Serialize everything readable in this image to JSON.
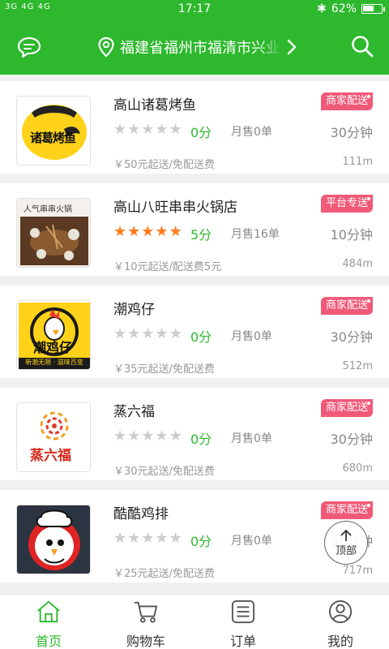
{
  "status": {
    "time": "17:17",
    "network": "3G 4G 4G",
    "battery": "62%",
    "battery_level": 0.62
  },
  "header": {
    "location": "福建省福州市福清市兴业"
  },
  "restaurants": [
    {
      "name": "高山诸葛烤鱼",
      "badge": "商家配送",
      "rating": 0,
      "score": "0分",
      "sales": "月售0单",
      "time": "30分钟",
      "fee": "￥50元起送/免配送费",
      "distance": "111m",
      "logo_text": "诸葛烤鱼"
    },
    {
      "name": "高山八旺串串火锅店",
      "badge": "平台专送",
      "rating": 5,
      "score": "5分",
      "sales": "月售16单",
      "time": "10分钟",
      "fee": "￥10元起送/配送费5元",
      "distance": "484m",
      "logo_text": "人气串串火锅"
    },
    {
      "name": "潮鸡仔",
      "badge": "商家配送",
      "rating": 0,
      "score": "0分",
      "sales": "月售0单",
      "time": "30分钟",
      "fee": "￥35元起送/免配送费",
      "distance": "512m",
      "logo_text": "潮鸡仔",
      "logo_sub": "新潮无限 · 滋味百变"
    },
    {
      "name": "蒸六福",
      "badge": "商家配送",
      "rating": 0,
      "score": "0分",
      "sales": "月售0单",
      "time": "30分钟",
      "fee": "￥30元起送/免配送费",
      "distance": "680m",
      "logo_text": "蒸六福"
    },
    {
      "name": "酷酷鸡排",
      "badge": "商家配送",
      "rating": 0,
      "score": "0分",
      "sales": "月售0单",
      "time": "30分钟",
      "fee": "￥25元起送/免配送费",
      "distance": "717m"
    }
  ],
  "top_button": {
    "label": "顶部"
  },
  "tabs": [
    {
      "label": "首页",
      "icon": "home-icon",
      "active": true
    },
    {
      "label": "购物车",
      "icon": "cart-icon",
      "active": false
    },
    {
      "label": "订单",
      "icon": "order-icon",
      "active": false
    },
    {
      "label": "我的",
      "icon": "profile-icon",
      "active": false
    }
  ],
  "colors": {
    "brand": "#2eb82e",
    "badge": "#f05a78",
    "star_active": "#ff7a1a",
    "star_inactive": "#cccccc"
  }
}
